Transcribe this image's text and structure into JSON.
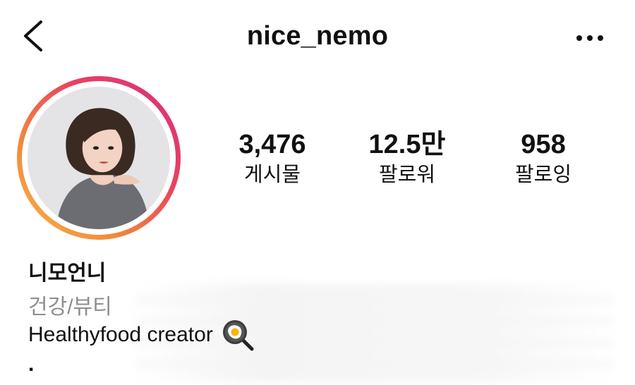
{
  "header": {
    "username": "nice_nemo",
    "back_icon": "chevron-left-icon",
    "more_icon": "more-horizontal-icon"
  },
  "profile": {
    "avatar_icon": "profile-photo",
    "stats": [
      {
        "value": "3,476",
        "label": "게시물"
      },
      {
        "value": "12.5만",
        "label": "팔로워"
      },
      {
        "value": "958",
        "label": "팔로잉"
      }
    ],
    "display_name": "니모언니",
    "category": "건강/뷰티",
    "bio_text": "Healthyfood creator",
    "bio_emoji": "frying-pan-egg-emoji",
    "bio_dot": "."
  },
  "colors": {
    "ring_start": "#d92e7f",
    "ring_end": "#f9b54a",
    "category_gray": "#8e8e8e"
  }
}
